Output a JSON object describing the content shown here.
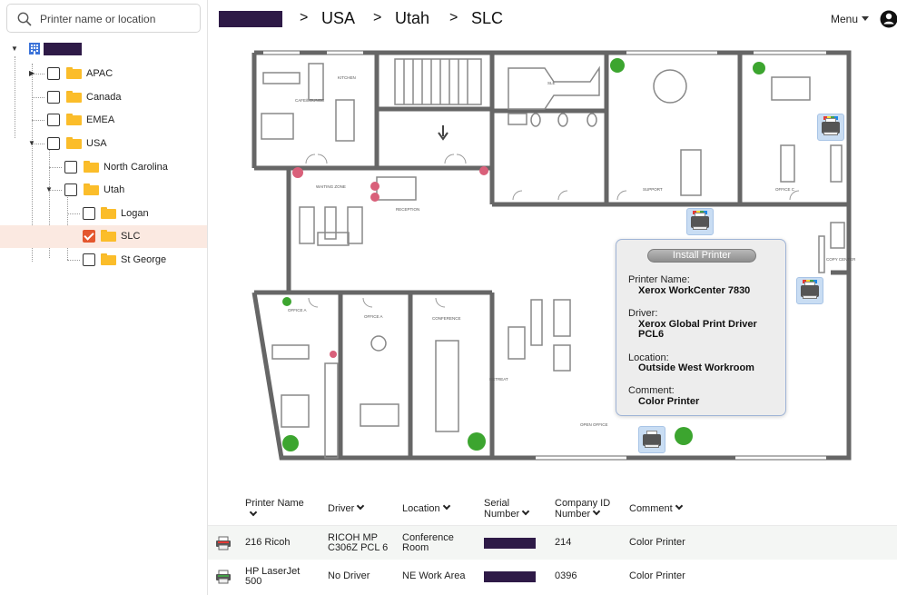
{
  "search": {
    "placeholder": "Printer name or location"
  },
  "tree": {
    "root_label": "",
    "items": [
      {
        "label": "APAC"
      },
      {
        "label": "Canada"
      },
      {
        "label": "EMEA"
      },
      {
        "label": "USA"
      },
      {
        "label": "North Carolina"
      },
      {
        "label": "Utah"
      },
      {
        "label": "Logan"
      },
      {
        "label": "SLC"
      },
      {
        "label": "St George"
      }
    ],
    "selected": "SLC"
  },
  "breadcrumb": {
    "items": [
      {
        "label": "USA"
      },
      {
        "label": "Utah"
      },
      {
        "label": "SLC"
      }
    ],
    "separator": ">"
  },
  "header": {
    "menu_label": "Menu"
  },
  "floorplan": {
    "room_labels": {
      "kitchen": "KITCHEN",
      "cafe": "CAFE/LOUNGE",
      "sle": "SLE",
      "support": "SUPPORT",
      "office_c": "OFFICE C",
      "waiting": "WAITING ZONE",
      "reception": "RECEPTION",
      "copy": "COPY CENTER",
      "office_a": "OFFICE A",
      "office_b": "OFFICE A",
      "conference": "CONFERENCE",
      "retreat": "RETREAT",
      "open_office": "OPEN OFFICE"
    }
  },
  "tooltip": {
    "install_label": "Install Printer",
    "printer_name_label": "Printer Name:",
    "printer_name": "Xerox WorkCenter 7830",
    "driver_label": "Driver:",
    "driver": "Xerox Global Print Driver PCL6",
    "location_label": "Location:",
    "location": "Outside West Workroom",
    "comment_label": "Comment:",
    "comment": "Color Printer"
  },
  "table": {
    "headers": {
      "printer_name": "Printer Name",
      "driver": "Driver",
      "location": "Location",
      "serial": "Serial Number",
      "company_id": "Company ID Number",
      "comment": "Comment"
    },
    "rows": [
      {
        "name": "216 Ricoh",
        "driver": "RICOH MP C306Z PCL 6",
        "location": "Conference Room",
        "serial": "",
        "company_id": "214",
        "comment": "Color Printer"
      },
      {
        "name": "HP LaserJet 500",
        "driver": "No Driver",
        "location": "NE Work Area",
        "serial": "",
        "company_id": "0396",
        "comment": "Color Printer"
      }
    ]
  },
  "colors": {
    "accent": "#e4572e",
    "selected_row_bg": "#fbe9e1",
    "redaction": "#2e1a47",
    "folder": "#fbbd2a"
  }
}
